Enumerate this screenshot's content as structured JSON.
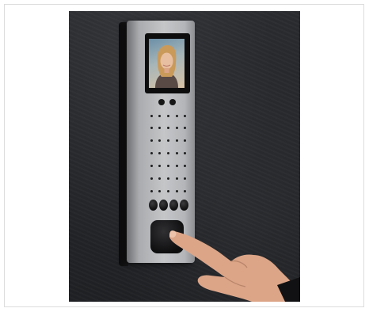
{
  "image": {
    "subject": "intercom-with-video-screen",
    "screen_icon": "person-portrait-icon",
    "hand_icon": "pointing-hand-icon",
    "colors": {
      "wall": "#24262a",
      "panel": "#b3b5b8",
      "screen_frame": "#0d0d0e",
      "skin": "#dca588"
    }
  }
}
